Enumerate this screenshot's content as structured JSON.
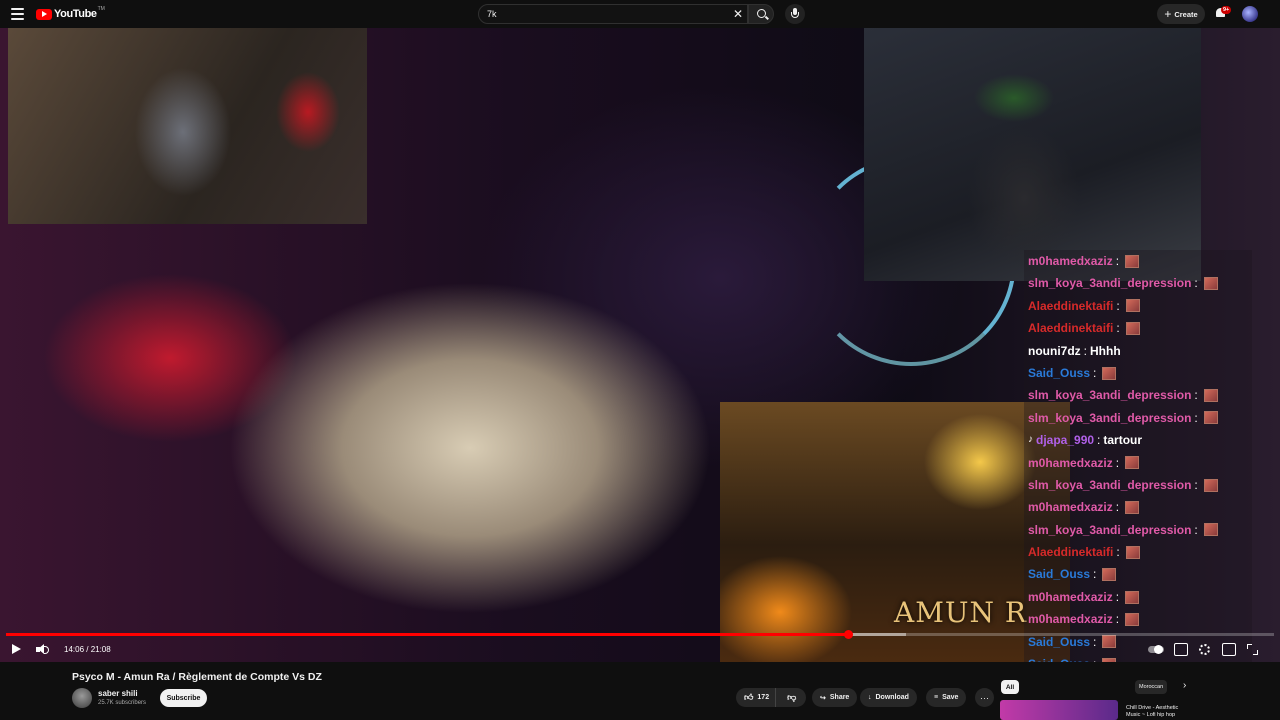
{
  "brand": {
    "name": "YouTube",
    "tm": "TM"
  },
  "search": {
    "value": "7k",
    "clear_icon": "close-icon",
    "button_icon": "search-icon"
  },
  "header": {
    "create_label": "Create",
    "notification_count": "9+"
  },
  "video": {
    "art_title": "AMUN R",
    "time": "14:06 / 21:08",
    "progress": 0.664,
    "buffered": 0.71
  },
  "chat": [
    {
      "user": "m0hamedxaziz",
      "color": "#e05aa8",
      "sep": ":",
      "text": "",
      "emote": true
    },
    {
      "user": "slm_koya_3andi_depression",
      "color": "#e05aa8",
      "sep": ":",
      "text": "",
      "emote": true
    },
    {
      "user": "Alaeddinektaifi",
      "color": "#d62a2a",
      "sep": ":",
      "text": "",
      "emote": true
    },
    {
      "user": "Alaeddinektaifi",
      "color": "#d62a2a",
      "sep": ":",
      "text": "",
      "emote": true
    },
    {
      "user": "nouni7dz",
      "color": "#ffffff",
      "sep": ":",
      "text": "Hhhh",
      "emote": false
    },
    {
      "user": "Said_Ouss",
      "color": "#2a7ad8",
      "sep": ":",
      "text": "",
      "emote": true
    },
    {
      "user": "slm_koya_3andi_depression",
      "color": "#e05aa8",
      "sep": ":",
      "text": "",
      "emote": true
    },
    {
      "user": "slm_koya_3andi_depression",
      "color": "#e05aa8",
      "sep": ":",
      "text": "",
      "emote": true
    },
    {
      "user": "djapa_990",
      "color": "#b060e8",
      "sep": ":",
      "text": "tartour",
      "emote": false,
      "prefix": "♪"
    },
    {
      "user": "m0hamedxaziz",
      "color": "#e05aa8",
      "sep": ":",
      "text": "",
      "emote": true
    },
    {
      "user": "slm_koya_3andi_depression",
      "color": "#e05aa8",
      "sep": ":",
      "text": "",
      "emote": true
    },
    {
      "user": "m0hamedxaziz",
      "color": "#e05aa8",
      "sep": ":",
      "text": "",
      "emote": true
    },
    {
      "user": "slm_koya_3andi_depression",
      "color": "#e05aa8",
      "sep": ":",
      "text": "",
      "emote": true
    },
    {
      "user": "Alaeddinektaifi",
      "color": "#d62a2a",
      "sep": ":",
      "text": "",
      "emote": true
    },
    {
      "user": "Said_Ouss",
      "color": "#2a7ad8",
      "sep": ":",
      "text": "",
      "emote": true
    },
    {
      "user": "m0hamedxaziz",
      "color": "#e05aa8",
      "sep": ":",
      "text": "",
      "emote": true
    },
    {
      "user": "m0hamedxaziz",
      "color": "#e05aa8",
      "sep": ":",
      "text": "",
      "emote": true
    },
    {
      "user": "Said_Ouss",
      "color": "#2a7ad8",
      "sep": ":",
      "text": "",
      "emote": true
    },
    {
      "user": "Said_Ouss",
      "color": "#2a7ad8",
      "sep": ":",
      "text": "",
      "emote": true
    }
  ],
  "info": {
    "title": "Psyco M - Amun Ra / Règlement de Compte Vs DZ",
    "channel": "saber shili",
    "subscribers": "25.7K subscribers",
    "subscribe_label": "Subscribe",
    "likes": "172",
    "share_label": "Share",
    "download_label": "Download",
    "save_label": "Save",
    "more_label": "···"
  },
  "sidebar": {
    "chip_all": "All",
    "chip_moroccan": "Moroccan",
    "rec_title": "Chill Drive - Aesthetic Music ~ Lofi hip hop"
  }
}
